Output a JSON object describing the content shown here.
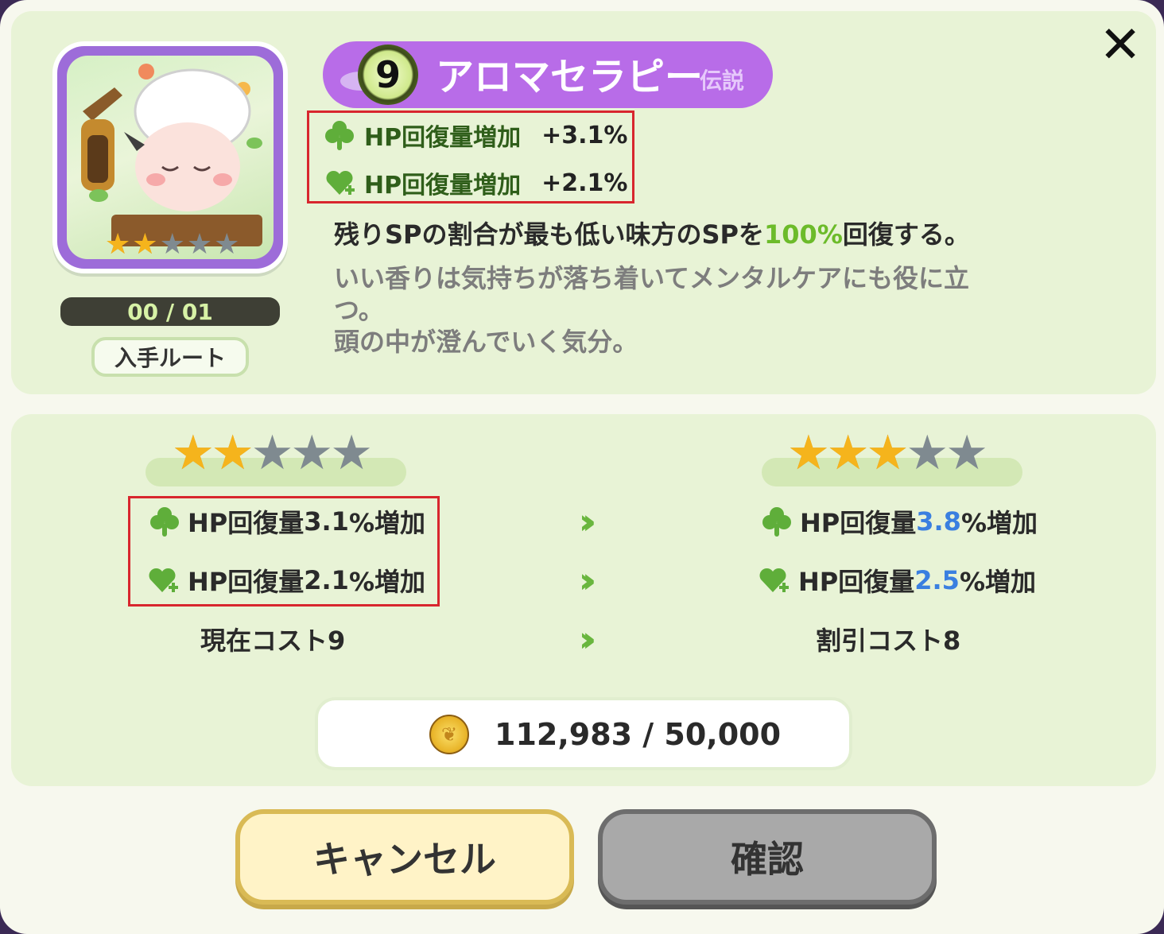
{
  "header": {
    "level": "9",
    "title": "アロマセラピー",
    "rarity": "伝説",
    "close_icon": "close-icon"
  },
  "card": {
    "stars_filled": 2,
    "stars_total": 5,
    "count": "00 / 01",
    "route_label": "入手ルート"
  },
  "bonuses": [
    {
      "icon": "clover-icon",
      "label": "HP回復量増加",
      "value": "+3.1%"
    },
    {
      "icon": "heart-plus-icon",
      "label": "HP回復量増加",
      "value": "+2.1%"
    }
  ],
  "description": {
    "pre": "残りSPの割合が最も低い味方のSPを",
    "highlight": "100%",
    "post": "回復する。",
    "flavor_1": "いい香りは気持ちが落ち着いてメンタルケアにも役に立",
    "flavor_2": "つ。",
    "flavor_3": "頭の中が澄んでいく気分。"
  },
  "compare": {
    "current_stars": 2,
    "next_stars": 3,
    "current": {
      "line1_pre": "HP回復量",
      "line1_val": "3.1",
      "line1_post": "%増加",
      "line2_pre": "HP回復量",
      "line2_val": "2.1",
      "line2_post": "%増加",
      "cost": "現在コスト9"
    },
    "next": {
      "line1_pre": "HP回復量",
      "line1_val": "3.8",
      "line1_post": "%増加",
      "line2_pre": "HP回復量",
      "line2_val": "2.5",
      "line2_post": "%増加",
      "cost": "割引コスト8"
    }
  },
  "coins": {
    "text": "112,983 / 50,000",
    "icon": "coin-icon"
  },
  "buttons": {
    "cancel": "キャンセル",
    "confirm": "確認"
  },
  "colors": {
    "accent_purple": "#b86ce8",
    "highlight_green": "#6cbb2a",
    "highlight_blue": "#3a7fe0",
    "box_red": "#d8262e"
  }
}
